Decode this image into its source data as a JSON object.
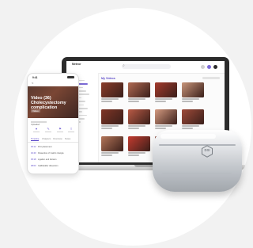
{
  "laptop": {
    "brand": "Meteor",
    "section_title": "My Videos",
    "tiles": [
      {
        "color": "#8a3c2a"
      },
      {
        "color": "#b06a52"
      },
      {
        "color": "#a43a2c"
      },
      {
        "color": "#c8957a"
      },
      {
        "color": "#7f3526"
      },
      {
        "color": "#b95a45"
      },
      {
        "color": "#d49a80"
      },
      {
        "color": "#9e4a39"
      },
      {
        "color": "#b37558"
      },
      {
        "color": "#c33b2f"
      },
      {
        "color": "#8d5041"
      },
      {
        "color": "#caa08a"
      }
    ]
  },
  "phone": {
    "time": "9:41",
    "back": "<",
    "video_title": "Video (36) Cholecystectomy complication",
    "badge": "Video",
    "meta": "Uploaded",
    "tabs": [
      "Timeline",
      "Chapters",
      "Overview",
      "Notes"
    ],
    "rows": [
      {
        "time": "00:12",
        "text": "Port placement"
      },
      {
        "time": "02:40",
        "text": "Dissection of Calot's triangle"
      },
      {
        "time": "05:18",
        "text": "Ligation and division"
      },
      {
        "time": "08:03",
        "text": "Gallbladder dissection"
      }
    ]
  },
  "device": {
    "logo_text": "DSI"
  },
  "colors": {
    "accent": "#5b49c9",
    "avatar1": "#7c6bd6",
    "avatar2": "#2b2b2b"
  }
}
